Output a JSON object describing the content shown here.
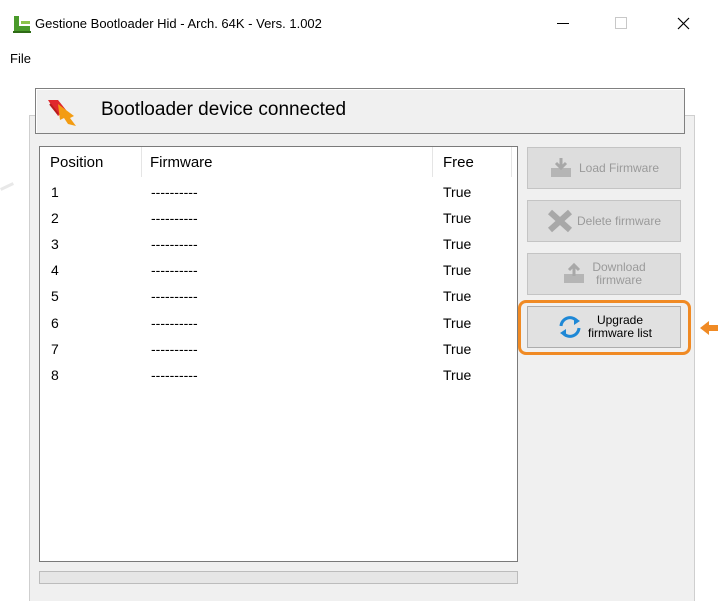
{
  "window": {
    "title": "Gestione Bootloader Hid - Arch. 64K - Vers. 1.002",
    "minimize_glyph": "—",
    "maximize_glyph": "☐",
    "close_glyph": "✕"
  },
  "menu": {
    "file": "File"
  },
  "status": {
    "text": "Bootloader device connected",
    "icon": "usb-plug-arrow-icon"
  },
  "list": {
    "headers": {
      "position": "Position",
      "firmware": "Firmware",
      "free": "Free"
    },
    "rows": [
      {
        "position": "1",
        "firmware": "----------",
        "free": "True"
      },
      {
        "position": "2",
        "firmware": "----------",
        "free": "True"
      },
      {
        "position": "3",
        "firmware": "----------",
        "free": "True"
      },
      {
        "position": "4",
        "firmware": "----------",
        "free": "True"
      },
      {
        "position": "5",
        "firmware": "----------",
        "free": "True"
      },
      {
        "position": "6",
        "firmware": "----------",
        "free": "True"
      },
      {
        "position": "7",
        "firmware": "----------",
        "free": "True"
      },
      {
        "position": "8",
        "firmware": "----------",
        "free": "True"
      }
    ]
  },
  "buttons": {
    "load": {
      "line1": "Load Firmware",
      "line2": "",
      "enabled": false
    },
    "delete": {
      "line1": "Delete firmware",
      "line2": "",
      "enabled": false
    },
    "download": {
      "line1": "Download",
      "line2": "firmware",
      "enabled": false
    },
    "upgrade": {
      "line1": "Upgrade",
      "line2": "firmware list",
      "enabled": true
    }
  },
  "colors": {
    "highlight": "#f08a24",
    "accent_blue": "#1e88d6"
  }
}
